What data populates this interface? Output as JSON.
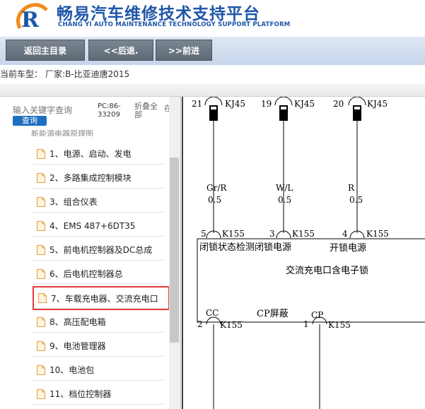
{
  "header": {
    "brand_title": "畅易汽车维修技术支持平台",
    "brand_subtitle": "CHANG YI AUTO MAINTENANCE TECHNOLOGY SUPPORT PLATFORM",
    "brand_color": "#1f56a8"
  },
  "nav": {
    "home_label": "返回主目录",
    "back_label": "<<后退.",
    "forward_label": ">>前进"
  },
  "current_model": {
    "label": "当前车型：",
    "value": "厂家:B-比亚迪唐2015"
  },
  "sidebar": {
    "search_placeholder": "输入关键字查询",
    "search_button": "查询",
    "pc_code": "PC:86-33209",
    "collapse_all": "折叠全部",
    "collapse_more": "在",
    "partial_item": "新能源电器原理图",
    "items": [
      {
        "label": "1、电源、启动、发电",
        "selected": false
      },
      {
        "label": "2、多路集成控制模块",
        "selected": false
      },
      {
        "label": "3、组合仪表",
        "selected": false
      },
      {
        "label": "4、EMS 487+6DT35",
        "selected": false
      },
      {
        "label": "5、前电机控制器及DC总成",
        "selected": false
      },
      {
        "label": "6、后电机控制器总",
        "selected": false
      },
      {
        "label": "7、车载充电器、交流充电口",
        "selected": true
      },
      {
        "label": "8、高压配电箱",
        "selected": false
      },
      {
        "label": "9、电池管理器",
        "selected": false
      },
      {
        "label": "10、电池包",
        "selected": false
      },
      {
        "label": "11、档位控制器",
        "selected": false
      }
    ],
    "selected_color": "#e03a3a"
  },
  "diagram": {
    "top_pins": [
      {
        "pin": "21",
        "conn": "KJ45",
        "wire": "Gr/R",
        "gauge": "0.5"
      },
      {
        "pin": "19",
        "conn": "KJ45",
        "wire": "W/L",
        "gauge": "0.5"
      },
      {
        "pin": "20",
        "conn": "KJ45",
        "wire": "R",
        "gauge": "0.5"
      }
    ],
    "mid_pins": [
      {
        "pin": "5",
        "conn": "K155"
      },
      {
        "pin": "3",
        "conn": "K155"
      },
      {
        "pin": "4",
        "conn": "K155"
      }
    ],
    "box_label_1": "闭锁状态检测闭锁电源",
    "box_label_2": "开锁电源",
    "box_title": "交流充电口含电子锁",
    "signal_cc": "CC",
    "signal_shield": "CP屏蔽",
    "signal_cp": "CP",
    "bottom_pins": [
      {
        "pin": "2",
        "conn": "K155"
      },
      {
        "pin": "1",
        "conn": "K155"
      }
    ]
  }
}
